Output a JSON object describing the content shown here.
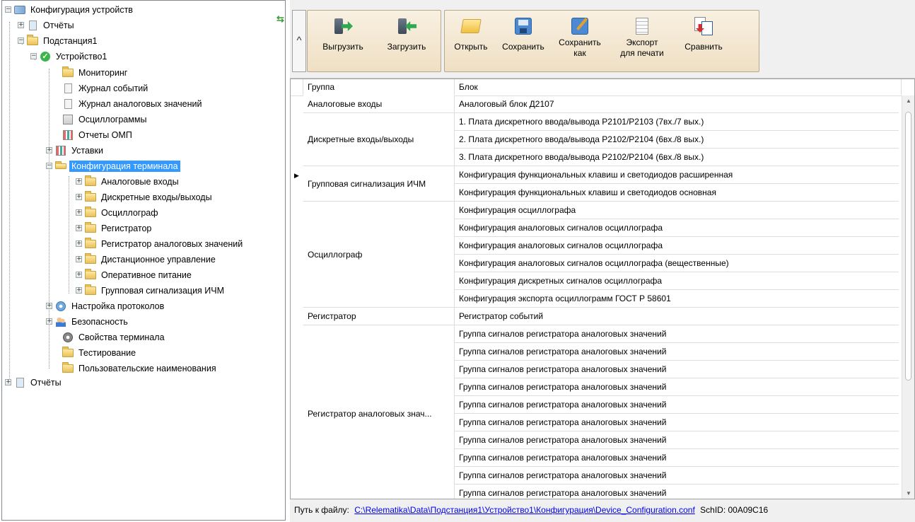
{
  "tree": {
    "root": "Конфигурация устройств",
    "reports1": "Отчёты",
    "substation": "Подстанция1",
    "device": "Устройство1",
    "children": [
      "Мониторинг",
      "Журнал событий",
      "Журнал аналоговых значений",
      "Осциллограммы",
      "Отчеты ОМП",
      "Уставки",
      "Конфигурация терминала"
    ],
    "config_children": [
      "Аналоговые входы",
      "Дискретные входы/выходы",
      "Осциллограф",
      "Регистратор",
      "Регистратор аналоговых значений",
      "Дистанционное управление",
      "Оперативное питание",
      "Групповая сигнализация ИЧМ"
    ],
    "after": [
      "Настройка протоколов",
      "Безопасность",
      "Свойства терминала",
      "Тестирование",
      "Пользовательские наименования"
    ],
    "reports2": "Отчёты"
  },
  "toolbar": {
    "collapse": "^",
    "export": "Выгрузить",
    "import": "Загрузить",
    "open": "Открыть",
    "save": "Сохранить",
    "saveas": "Сохранить\nкак",
    "print": "Экспорт\nдля печати",
    "compare": "Сравнить"
  },
  "grid": {
    "headers": [
      "Группа",
      "Блок"
    ],
    "groups": [
      "Аналоговые входы",
      "Дискретные входы/выходы",
      "Групповая сигнализация ИЧМ",
      "Осциллограф",
      "Регистратор",
      "Регистратор аналоговых знач..."
    ],
    "blocks": [
      "Аналоговый блок Д2107",
      "1. Плата дискретного ввода/вывода Р2101/Р2103 (7вх./7 вых.)",
      "2. Плата дискретного ввода/вывода Р2102/Р2104 (6вх./8 вых.)",
      "3. Плата дискретного ввода/вывода Р2102/Р2104 (6вх./8 вых.)",
      "Конфигурация функциональных клавиш и светодиодов расширенная",
      "Конфигурация функциональных клавиш и светодиодов основная",
      "Конфигурация осциллографа",
      "Конфигурация аналоговых сигналов осциллографа",
      "Конфигурация аналоговых сигналов осциллографа",
      "Конфигурация аналоговых сигналов осциллографа (вещественные)",
      "Конфигурация дискретных сигналов осциллографа",
      "Конфигурация экспорта осциллограмм ГОСТ Р 58601",
      "Регистратор событий",
      "Группа сигналов регистратора аналоговых значений",
      "Группа сигналов регистратора аналоговых значений",
      "Группа сигналов регистратора аналоговых значений",
      "Группа сигналов регистратора аналоговых значений",
      "Группа сигналов регистратора аналоговых значений",
      "Группа сигналов регистратора аналоговых значений",
      "Группа сигналов регистратора аналоговых значений",
      "Группа сигналов регистратора аналоговых значений",
      "Группа сигналов регистратора аналоговых значений",
      "Группа сигналов регистратора аналоговых значений"
    ]
  },
  "status": {
    "label": "Путь к файлу:",
    "path": "C:\\Relematika\\Data\\Подстанция1\\Устройство1\\Конфигурация\\Device_Configuration.conf",
    "schid": "SchID: 00A09C16"
  }
}
